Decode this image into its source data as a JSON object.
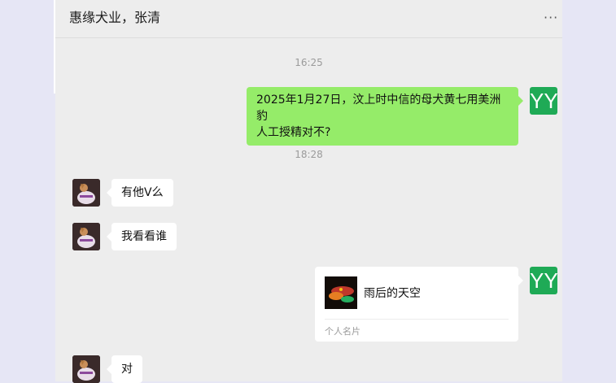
{
  "chat": {
    "title": "惠缘犬业，张清",
    "more_icon": "more-dots-icon"
  },
  "messages": [
    {
      "type": "time",
      "text": "16:25"
    },
    {
      "type": "outgoing",
      "line1": "2025年1月27日，汶上时中信的母犬黄七用美洲豹",
      "line2": "人工授精对不?",
      "avatar_text": "YY"
    },
    {
      "type": "time",
      "text": "18:28"
    },
    {
      "type": "incoming",
      "text": "有他V么"
    },
    {
      "type": "incoming",
      "text": "我看看谁"
    },
    {
      "type": "outgoing_card",
      "name": "雨后的天空",
      "kind": "个人名片",
      "avatar_text": "YY"
    },
    {
      "type": "incoming",
      "text": "对"
    }
  ],
  "colors": {
    "outgoing_bubble": "#95ec69",
    "incoming_bubble": "#ffffff",
    "self_avatar": "#1faa56",
    "chat_bg": "#ededed"
  }
}
